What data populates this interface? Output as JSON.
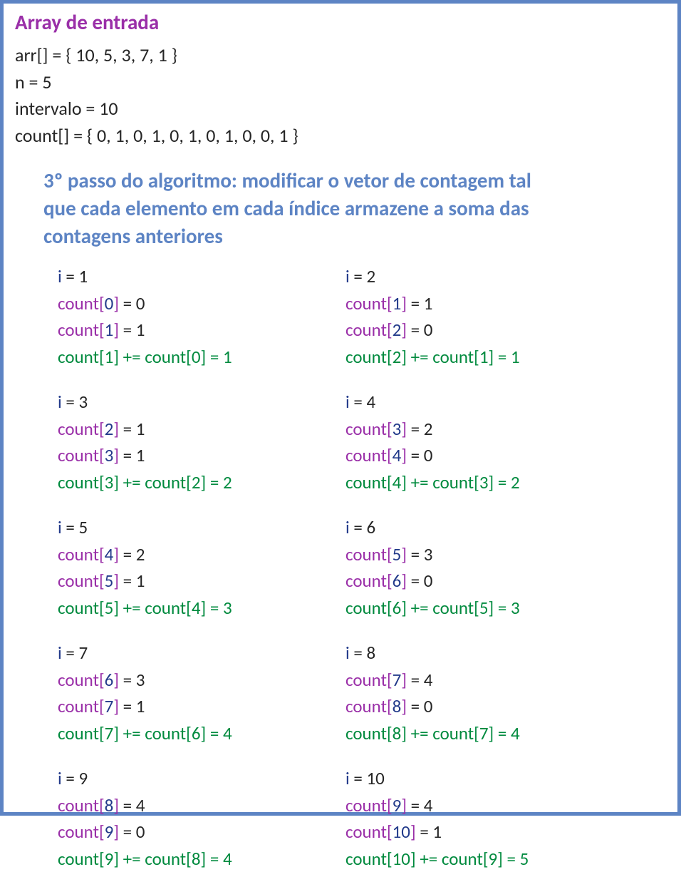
{
  "title": "Array de entrada",
  "lines": [
    "arr[] = { 10, 5, 3, 7, 1 }",
    "n = 5",
    "intervalo = 10",
    "count[] = { 0, 1, 0, 1, 0, 1, 0, 1, 0, 0, 1 }"
  ],
  "step_title": "3º passo do algoritmo: modificar o vetor de contagem tal que cada elemento em cada índice armazene a soma das contagens anteriores",
  "iterations": [
    {
      "i": 1,
      "prev_idx": 0,
      "prev_val": 0,
      "cur_idx": 1,
      "cur_val": 1,
      "result": 1
    },
    {
      "i": 2,
      "prev_idx": 1,
      "prev_val": 1,
      "cur_idx": 2,
      "cur_val": 0,
      "result": 1
    },
    {
      "i": 3,
      "prev_idx": 2,
      "prev_val": 1,
      "cur_idx": 3,
      "cur_val": 1,
      "result": 2
    },
    {
      "i": 4,
      "prev_idx": 3,
      "prev_val": 2,
      "cur_idx": 4,
      "cur_val": 0,
      "result": 2
    },
    {
      "i": 5,
      "prev_idx": 4,
      "prev_val": 2,
      "cur_idx": 5,
      "cur_val": 1,
      "result": 3
    },
    {
      "i": 6,
      "prev_idx": 5,
      "prev_val": 3,
      "cur_idx": 6,
      "cur_val": 0,
      "result": 3
    },
    {
      "i": 7,
      "prev_idx": 6,
      "prev_val": 3,
      "cur_idx": 7,
      "cur_val": 1,
      "result": 4
    },
    {
      "i": 8,
      "prev_idx": 7,
      "prev_val": 4,
      "cur_idx": 8,
      "cur_val": 0,
      "result": 4
    },
    {
      "i": 9,
      "prev_idx": 8,
      "prev_val": 4,
      "cur_idx": 9,
      "cur_val": 0,
      "result": 4
    },
    {
      "i": 10,
      "prev_idx": 9,
      "prev_val": 4,
      "cur_idx": 10,
      "cur_val": 1,
      "result": 5
    }
  ]
}
